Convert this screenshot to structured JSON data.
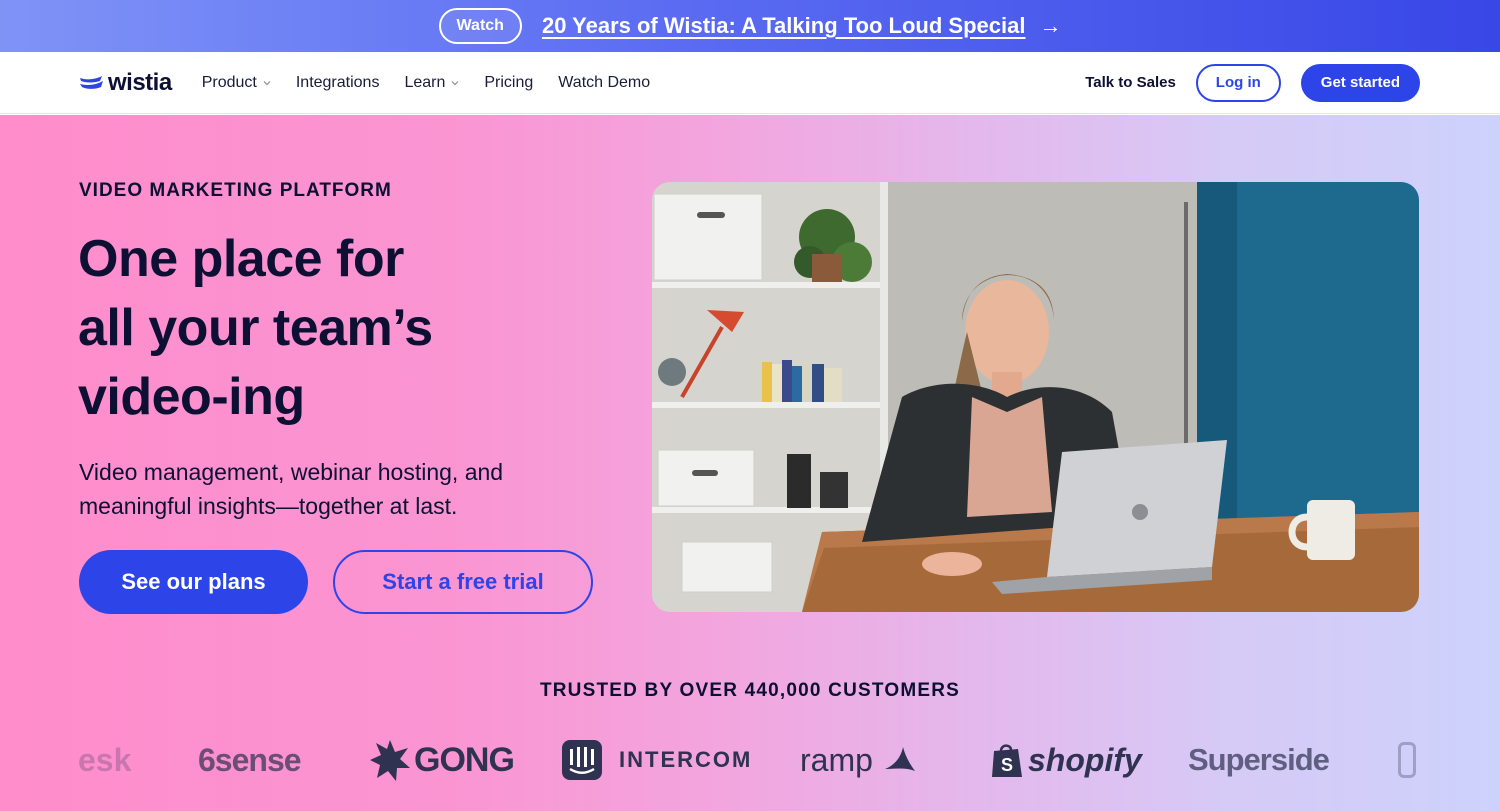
{
  "announcement": {
    "watch_label": "Watch",
    "headline": "20 Years of Wistia: A Talking Too Loud Special",
    "arrow": "→"
  },
  "nav": {
    "logo_text": "wistia",
    "links": [
      {
        "label": "Product",
        "dropdown": true
      },
      {
        "label": "Integrations",
        "dropdown": false
      },
      {
        "label": "Learn",
        "dropdown": true
      },
      {
        "label": "Pricing",
        "dropdown": false
      },
      {
        "label": "Watch Demo",
        "dropdown": false
      }
    ],
    "talk_to_sales": "Talk to Sales",
    "login": "Log in",
    "get_started": "Get started"
  },
  "hero": {
    "eyebrow": "VIDEO MARKETING PLATFORM",
    "title_lines": [
      "One place for",
      "all your team’s",
      "video-ing"
    ],
    "subtitle_lines": [
      "Video management, webinar hosting, and",
      "meaningful insights—together at last."
    ],
    "primary_cta": "See our plans",
    "secondary_cta": "Start a free trial"
  },
  "trusted": {
    "heading": "TRUSTED BY OVER 440,000 CUSTOMERS",
    "logos": [
      "esk",
      "6sense",
      "GONG",
      "INTERCOM",
      "ramp",
      "shopify",
      "Superside"
    ]
  },
  "colors": {
    "brand_blue": "#2d45e8",
    "ink": "#0d1033",
    "hero_pink": "#ff8ccb",
    "hero_lavender": "#cdd2fc"
  }
}
